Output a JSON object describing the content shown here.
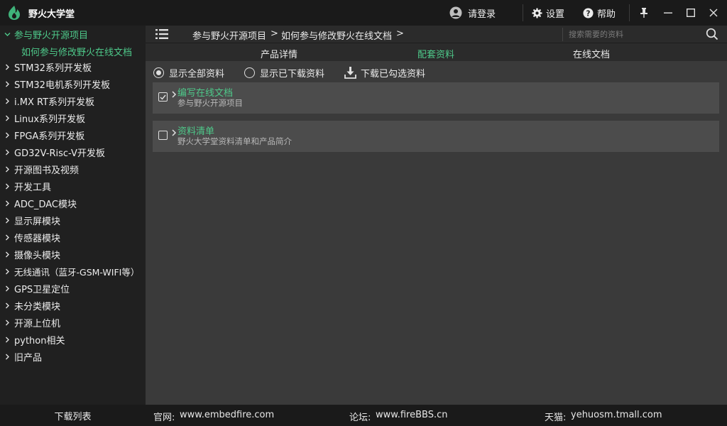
{
  "titlebar": {
    "app_title": "野火大学堂",
    "login_label": "请登录",
    "settings_label": "设置",
    "help_label": "帮助"
  },
  "sidebar": {
    "items": [
      {
        "label": "参与野火开源项目",
        "expanded": true
      },
      {
        "label": "STM32系列开发板"
      },
      {
        "label": "STM32电机系列开发板"
      },
      {
        "label": "i.MX RT系列开发板"
      },
      {
        "label": "Linux系列开发板"
      },
      {
        "label": "FPGA系列开发板"
      },
      {
        "label": "GD32V-Risc-V开发板"
      },
      {
        "label": "开源图书及视频"
      },
      {
        "label": "开发工具"
      },
      {
        "label": "ADC_DAC模块"
      },
      {
        "label": "显示屏模块"
      },
      {
        "label": "传感器模块"
      },
      {
        "label": "摄像头模块"
      },
      {
        "label": "无线通讯（蓝牙-GSM-WIFI等）"
      },
      {
        "label": "GPS卫星定位"
      },
      {
        "label": "未分类模块"
      },
      {
        "label": "开源上位机"
      },
      {
        "label": "python相关"
      },
      {
        "label": "旧产品"
      }
    ],
    "sub_item": "如何参与修改野火在线文档",
    "download_list": "下载列表"
  },
  "breadcrumb": {
    "part1": "参与野火开源项目",
    "sep1": ">",
    "part2": "如何参与修改野火在线文档",
    "sep2": ">"
  },
  "search": {
    "placeholder": "搜索需要的资料"
  },
  "tabs": [
    {
      "label": "产品详情"
    },
    {
      "label": "配套资料",
      "active": true
    },
    {
      "label": "在线文档"
    }
  ],
  "filters": {
    "show_all": "显示全部资料",
    "show_downloaded": "显示已下载资料",
    "download_checked": "下载已勾选资料"
  },
  "resources": [
    {
      "title": "编写在线文档",
      "subtitle": "参与野火开源项目",
      "checked": true
    },
    {
      "title": "资料清单",
      "subtitle": "野火大学堂资料清单和产品简介",
      "checked": false
    }
  ],
  "footer": {
    "site_label": "官网:",
    "site_value": "www.embedfire.com",
    "forum_label": "论坛:",
    "forum_value": "www.fireBBS.cn",
    "tmall_label": "天猫:",
    "tmall_value": "yehuosm.tmall.com"
  },
  "colors": {
    "accent": "#4ec98a",
    "titlebar_bg": "#1a1a1a",
    "sidebar_bg": "#202020",
    "content_bg": "#3a3a3a",
    "card_bg": "#4c4c4c"
  }
}
